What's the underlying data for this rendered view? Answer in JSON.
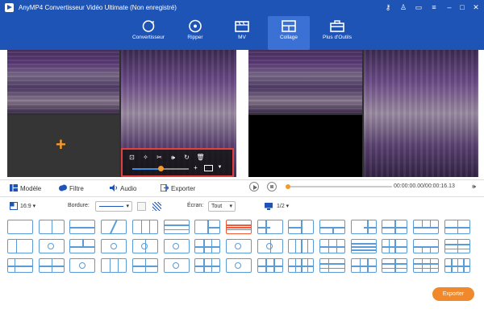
{
  "app": {
    "title": "AnyMP4 Convertisseur Vidéo Ultimate (Non enregistré)"
  },
  "window_controls": [
    {
      "name": "key-icon",
      "glyph": "⚷"
    },
    {
      "name": "user-icon",
      "glyph": "♙"
    },
    {
      "name": "chat-icon",
      "glyph": "▭"
    },
    {
      "name": "menu-icon",
      "glyph": "≡"
    },
    {
      "name": "minimize-icon",
      "glyph": "–"
    },
    {
      "name": "maximize-icon",
      "glyph": "□"
    },
    {
      "name": "close-icon",
      "glyph": "✕"
    }
  ],
  "nav": [
    {
      "label": "Convertisseur",
      "icon": "convert-icon"
    },
    {
      "label": "Ripper",
      "icon": "disc-icon"
    },
    {
      "label": "MV",
      "icon": "mv-icon"
    },
    {
      "label": "Collage",
      "icon": "collage-icon",
      "active": true
    },
    {
      "label": "Plus d'Outils",
      "icon": "toolbox-icon"
    }
  ],
  "toolbox_icons": [
    "crop-icon",
    "magic-wand-icon",
    "scissors-icon",
    "audio-icon",
    "rotate-icon",
    "delete-icon"
  ],
  "toolbox_glyphs": [
    "⊡",
    "✧",
    "✂",
    "🕪",
    "↻",
    "🗑"
  ],
  "volume": {
    "level": 0.5
  },
  "tabs": [
    {
      "label": "Modèle",
      "icon": "template-icon"
    },
    {
      "label": "Filtre",
      "icon": "filter-icon"
    },
    {
      "label": "Audio",
      "icon": "audio-tab-icon"
    },
    {
      "label": "Exporter",
      "icon": "export-tab-icon"
    }
  ],
  "playback": {
    "time": "00:00:00.00/00:00:16.13",
    "progress": 0.0
  },
  "options": {
    "ratio": "16:9",
    "border_label": "Bordure:",
    "screen_label": "Écran:",
    "screen_value": "Tout",
    "page": "1/2"
  },
  "export_button": "Exporter",
  "colors": {
    "header": "#1e54b6",
    "active_tab": "#3b71d4",
    "accent": "#f0892b",
    "template_border": "#5b9bd8",
    "selected_template": "#ef5a3a"
  }
}
